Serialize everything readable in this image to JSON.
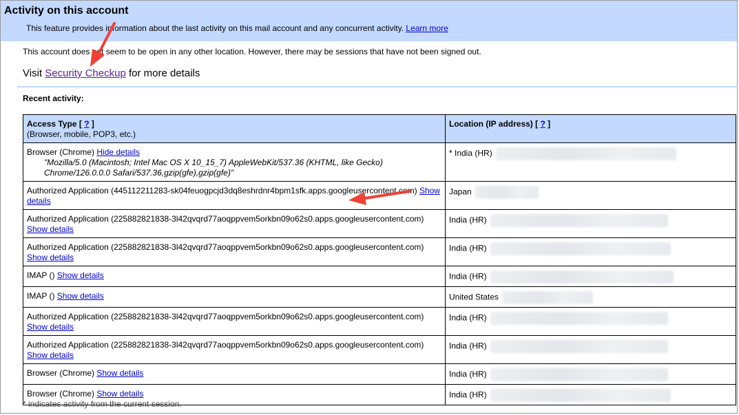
{
  "header": {
    "title": "Activity on this account",
    "description": "This feature provides information about the last activity on this mail account and any concurrent activity.",
    "learn_more": "Learn more"
  },
  "status": {
    "text": "This account does not seem to be open in any other location. However, there may be sessions that have not been signed out."
  },
  "visit": {
    "prefix": "Visit",
    "link": "Security Checkup",
    "suffix": "for more details"
  },
  "recent": {
    "label": "Recent activity:"
  },
  "table": {
    "access_header": "Access Type",
    "access_help": "?",
    "access_sub": "(Browser, mobile, POP3, etc.)",
    "location_header": "Location (IP address)",
    "location_help": "?",
    "rows": [
      {
        "access": "Browser (Chrome)",
        "link": "Hide details",
        "detail": "\"Mozilla/5.0 (Macintosh; Intel Mac OS X 10_15_7) AppleWebKit/537.36 (KHTML, like Gecko) Chrome/126.0.0.0 Safari/537.36,gzip(gfe),gzip(gfe)\"",
        "location": "* India (HR)"
      },
      {
        "access": "Authorized Application (445112211283-sk04feuogpcjd3dq8eshrdnr4bpm1sfk.apps.googleusercontent.com)",
        "link": "Show details",
        "location": "Japan"
      },
      {
        "access": "Authorized Application (225882821838-3l42qvqrd77aoqppvem5orkbn09o62s0.apps.googleusercontent.com)",
        "link": "Show details",
        "location": "India (HR)"
      },
      {
        "access": "Authorized Application (225882821838-3l42qvqrd77aoqppvem5orkbn09o62s0.apps.googleusercontent.com)",
        "link": "Show details",
        "location": "India (HR)"
      },
      {
        "access": "IMAP ()",
        "link": "Show details",
        "location": "India (HR)"
      },
      {
        "access": "IMAP ()",
        "link": "Show details",
        "location": "United States"
      },
      {
        "access": "Authorized Application (225882821838-3l42qvqrd77aoqppvem5orkbn09o62s0.apps.googleusercontent.com)",
        "link": "Show details",
        "location": "India (HR)"
      },
      {
        "access": "Authorized Application (225882821838-3l42qvqrd77aoqppvem5orkbn09o62s0.apps.googleusercontent.com)",
        "link": "Show details",
        "location": "India (HR)"
      },
      {
        "access": "Browser (Chrome)",
        "link": "Show details",
        "location": "India (HR)"
      },
      {
        "access": "Browser (Chrome)",
        "link": "Show details",
        "location": "India (HR)"
      }
    ]
  },
  "footnote": {
    "text": "* indicates activity from the current session."
  },
  "colors": {
    "header_bg": "#c3d9ff",
    "link": "#0000cc",
    "visited_link": "#5c1e8c",
    "annotation_arrow": "#ef4136"
  }
}
